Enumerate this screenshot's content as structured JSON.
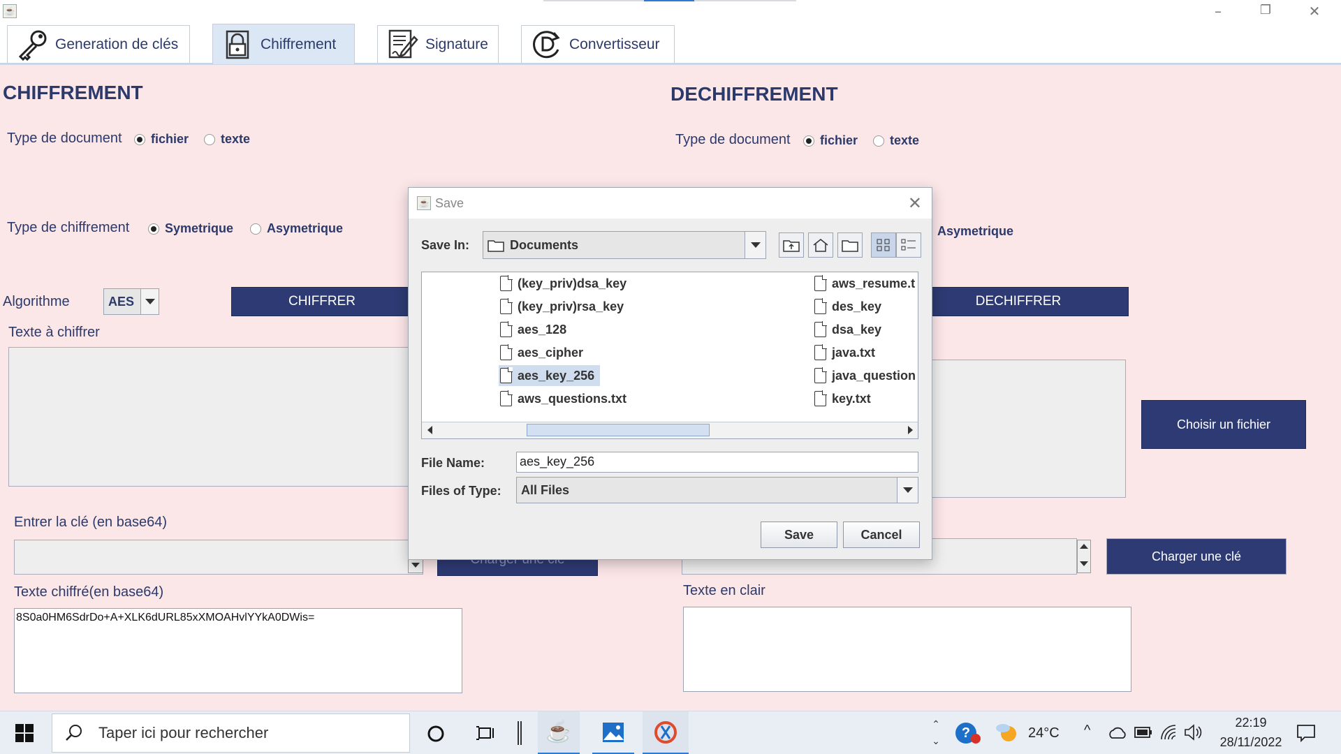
{
  "window": {
    "minimize": "–",
    "restore": "❐",
    "close": "✕"
  },
  "tabs": [
    {
      "label": "Generation de clés",
      "icon": "key-icon"
    },
    {
      "label": "Chiffrement",
      "icon": "lock-icon"
    },
    {
      "label": "Signature",
      "icon": "signature-icon"
    },
    {
      "label": "Convertisseur",
      "icon": "convert-icon"
    }
  ],
  "chiffrement": {
    "title": "CHIFFREMENT",
    "doc_type_label": "Type de document",
    "doc_opt_file": "fichier",
    "doc_opt_text": "texte",
    "cipher_type_label": "Type de chiffrement",
    "cipher_opt_sym": "Symetrique",
    "cipher_opt_asym": "Asymetrique",
    "algo_label": "Algorithme",
    "algo_value": "AES",
    "encrypt_button": "CHIFFRER",
    "text_to_encrypt_label": "Texte à chiffrer",
    "key_label": "Entrer la clé (en base64)",
    "load_key_button": "Charger une clé",
    "cipher_text_label": "Texte chiffré(en base64)",
    "cipher_text_value": "8S0a0HM6SdrDo+A+XLK6dURL85xXMOAHvlYYkA0DWis="
  },
  "dechiffrement": {
    "title": "DECHIFFREMENT",
    "doc_type_label": "Type de document",
    "doc_opt_file": "fichier",
    "doc_opt_text": "texte",
    "cipher_opt_asym": "Asymetrique",
    "decrypt_button": "DECHIFFRER",
    "choose_file_button": "Choisir un fichier",
    "load_key_button": "Charger une clé",
    "plain_text_label": "Texte en clair"
  },
  "dialog": {
    "title": "Save",
    "save_in_label": "Save In:",
    "save_in_value": "Documents",
    "files_col1": [
      "(key_priv)dsa_key",
      "(key_priv)rsa_key",
      "aes_128",
      "aes_cipher",
      "aes_key_256",
      "aws_questions.txt"
    ],
    "files_col2": [
      "aws_resume.t",
      "des_key",
      "dsa_key",
      "java.txt",
      "java_question",
      "key.txt"
    ],
    "selected_file": "aes_key_256",
    "file_name_label": "File Name:",
    "file_name_value": "aes_key_256",
    "file_type_label": "Files of Type:",
    "file_type_value": "All Files",
    "save_button": "Save",
    "cancel_button": "Cancel"
  },
  "taskbar": {
    "search_placeholder": "Taper ici pour rechercher",
    "temperature": "24°C",
    "time": "22:19",
    "date": "28/11/2022"
  },
  "colors": {
    "accent": "#2d3a73",
    "panel_bg": "#fbe6e8",
    "text": "#2c3a6b"
  }
}
